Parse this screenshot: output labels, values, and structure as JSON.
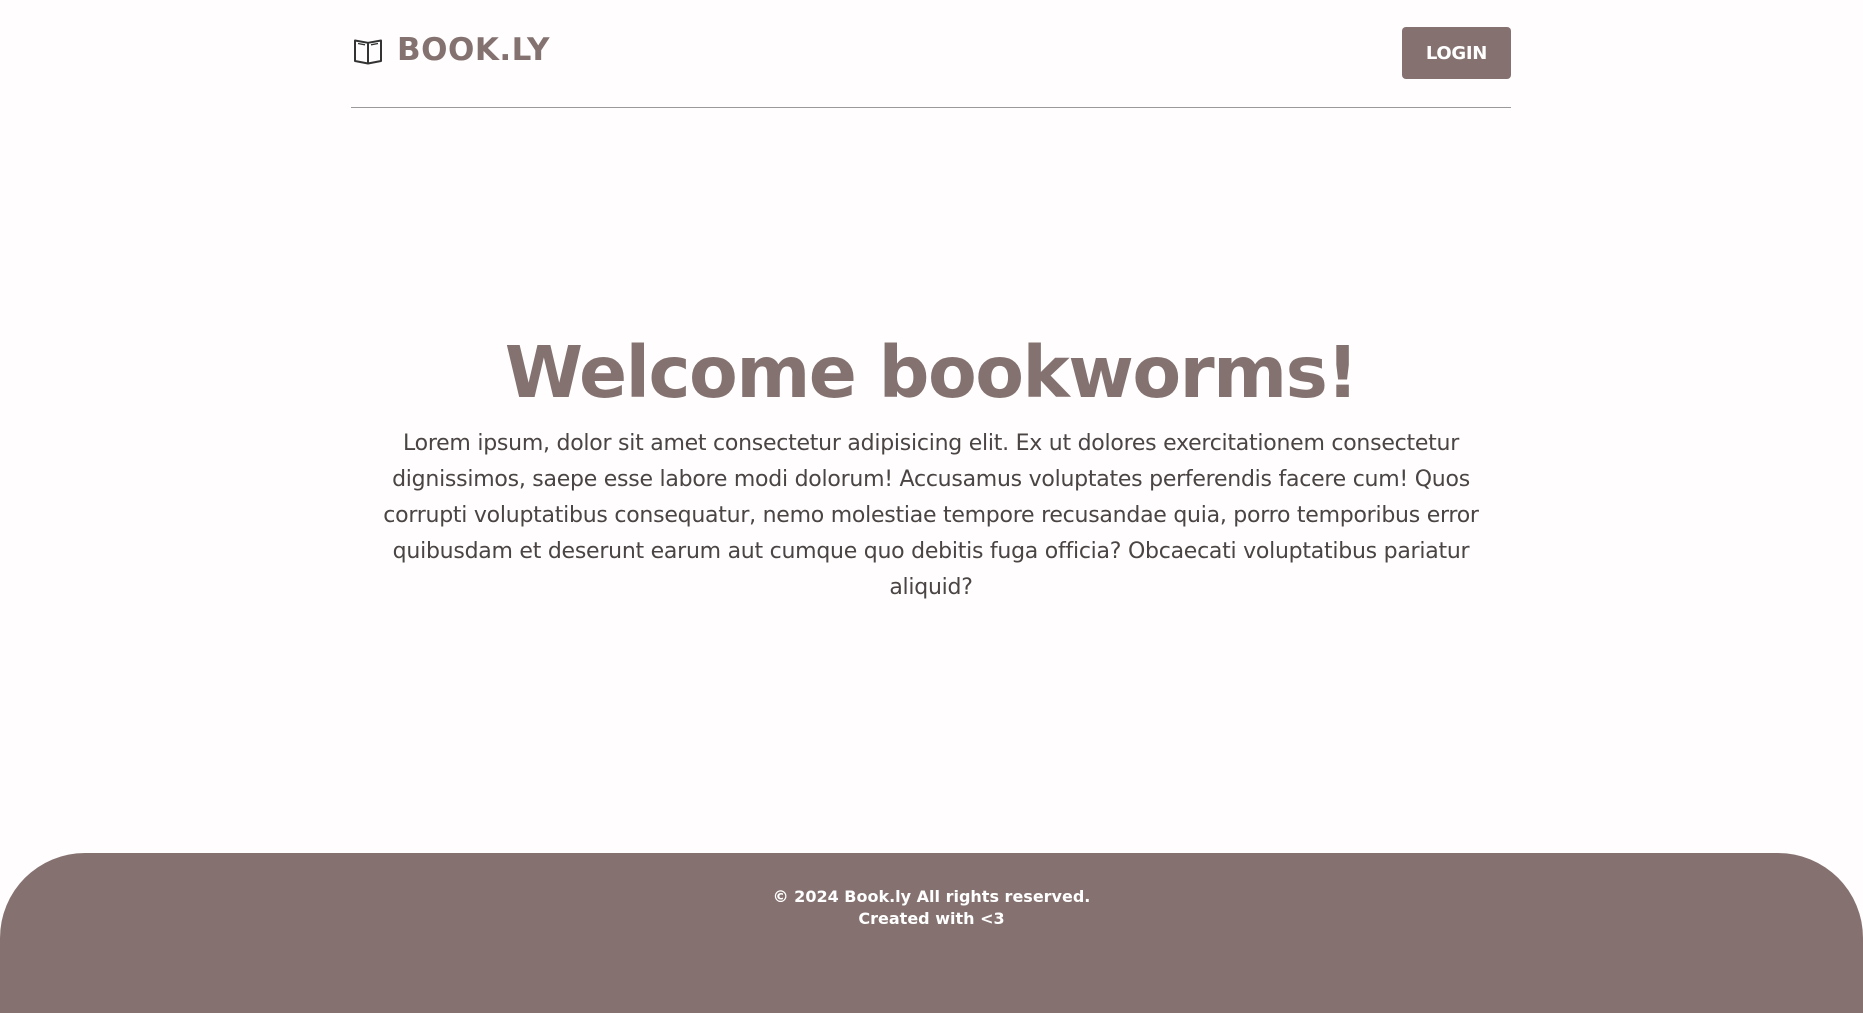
{
  "header": {
    "brand": {
      "name": "BOOK.LY",
      "icon": "book-icon"
    },
    "login_label": "LOGIN"
  },
  "hero": {
    "title": "Welcome bookworms!",
    "body": "Lorem ipsum, dolor sit amet consectetur adipisicing elit. Ex ut dolores exercitationem consectetur dignissimos, saepe esse labore modi dolorum! Accusamus voluptates perferendis facere cum! Quos corrupti voluptatibus consequatur, nemo molestiae tempore recusandae quia, porro temporibus error quibusdam et deserunt earum aut cumque quo debitis fuga officia? Obcaecati voluptatibus pariatur aliquid?"
  },
  "footer": {
    "copyright": "© 2024 Book.ly All rights reserved.",
    "credit": "Created with <3"
  },
  "colors": {
    "brand": "#847270",
    "background": "#fffdfd",
    "body_text": "#4a4444"
  }
}
